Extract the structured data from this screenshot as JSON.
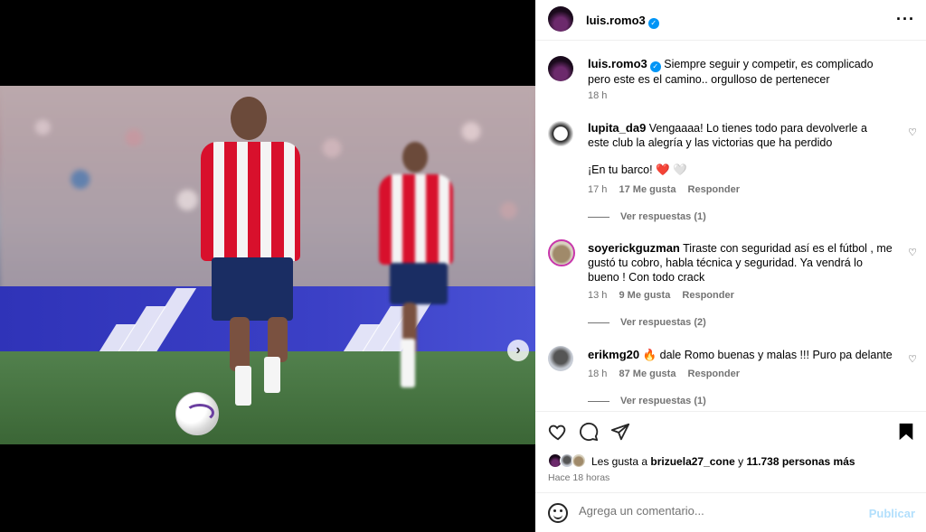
{
  "post": {
    "username": "luis.romo3",
    "verified": true,
    "caption": "Siempre seguir y competir, es complicado pero este es el camino.. orgulloso de pertenecer",
    "time": "18 h",
    "carousel_slides": 2,
    "carousel_active": 1
  },
  "header": {
    "username": "luis.romo3",
    "more_icon": "more-horizontal-icon"
  },
  "comments": [
    {
      "username": "lupita_da9",
      "text": "Vengaaaa! Lo tienes todo para devolverle a este club la alegría y las victorias que ha perdido",
      "text2": "¡En tu barco! ❤️ 🤍",
      "time": "17 h",
      "likes": "17 Me gusta",
      "reply": "Responder",
      "view_replies": "Ver respuestas (1)"
    },
    {
      "username": "soyerickguzman",
      "text": "Tiraste con seguridad así es el fútbol , me gustó tu cobro, habla técnica y seguridad. Ya vendrá lo bueno ! Con todo crack",
      "time": "13 h",
      "likes": "9 Me gusta",
      "reply": "Responder",
      "view_replies": "Ver respuestas (2)"
    },
    {
      "username": "erikmg20",
      "text": "🔥 dale Romo buenas y malas !!! Puro pa delante",
      "time": "18 h",
      "likes": "87 Me gusta",
      "reply": "Responder",
      "view_replies": "Ver respuestas (1)"
    }
  ],
  "actions": {
    "like_icon": "heart-icon",
    "comment_icon": "comment-icon",
    "share_icon": "share-icon",
    "save_icon": "bookmark-icon",
    "likes_prefix": "Les gusta a",
    "likes_user": "brizuela27_cone",
    "likes_join": "y",
    "likes_count": "11.738 personas más",
    "ago": "Hace 18 horas"
  },
  "add_comment": {
    "placeholder": "Agrega un comentario...",
    "publish": "Publicar"
  },
  "colors": {
    "accent": "#0095f6",
    "publish_disabled": "#b2dffc",
    "muted": "#737373"
  }
}
